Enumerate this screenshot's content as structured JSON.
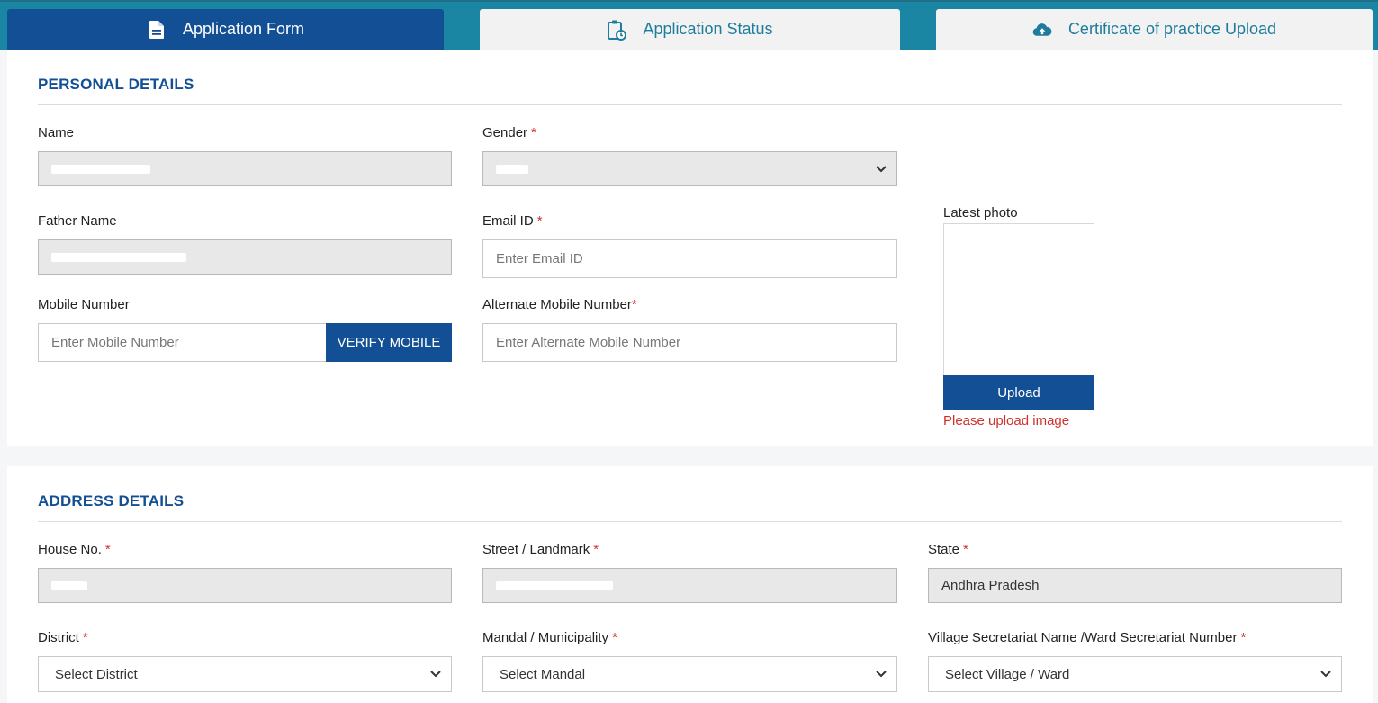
{
  "tabs": [
    {
      "label": "Application Form",
      "icon": "document-icon"
    },
    {
      "label": "Application Status",
      "icon": "clipboard-clock-icon"
    },
    {
      "label": "Certificate of practice Upload",
      "icon": "cloud-upload-icon"
    }
  ],
  "personal": {
    "title": "PERSONAL DETAILS",
    "name_label": "Name",
    "gender_label": "Gender",
    "father_label": "Father Name",
    "email_label": "Email ID",
    "email_placeholder": "Enter Email ID",
    "mobile_label": "Mobile Number",
    "mobile_placeholder": "Enter Mobile Number",
    "verify_button": "VERIFY MOBILE",
    "alt_mobile_label": "Alternate Mobile Number",
    "alt_mobile_placeholder": "Enter Alternate Mobile Number",
    "photo_label": "Latest photo",
    "upload_button": "Upload",
    "photo_error": "Please upload image"
  },
  "address": {
    "title": "ADDRESS DETAILS",
    "house_label": "House No.",
    "street_label": "Street / Landmark",
    "state_label": "State",
    "state_value": "Andhra Pradesh",
    "district_label": "District",
    "district_placeholder": "Select District",
    "mandal_label": "Mandal / Municipality",
    "mandal_placeholder": "Select Mandal",
    "village_label": "Village Secretariat Name /Ward Secretariat Number",
    "village_placeholder": "Select Village / Ward"
  },
  "required_mark": "*",
  "colors": {
    "primary": "#134f94",
    "accent": "#1a86a3",
    "error": "#d0312d"
  }
}
